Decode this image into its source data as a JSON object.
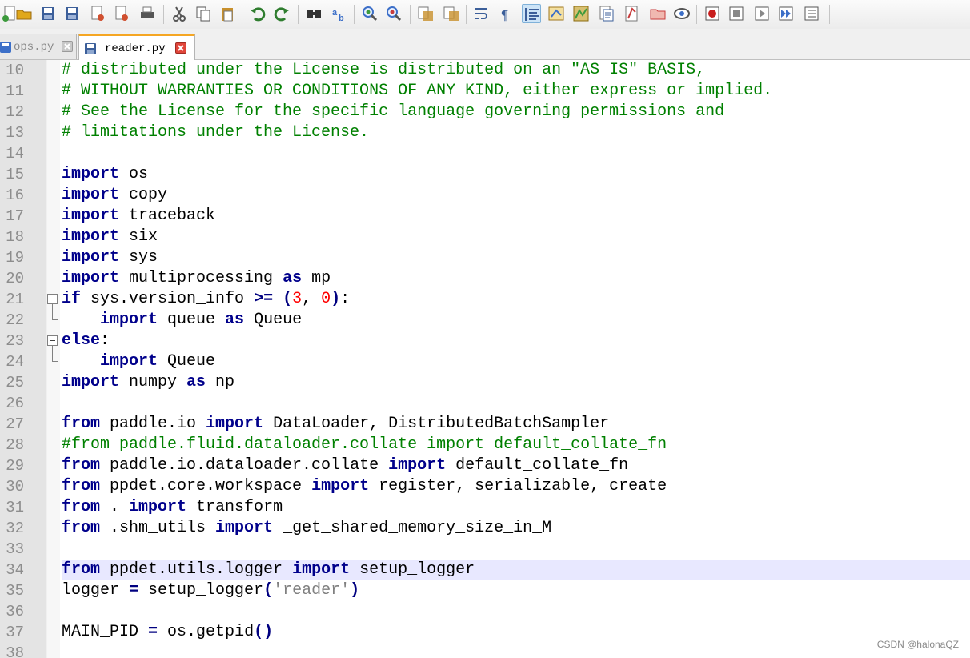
{
  "toolbar": {
    "buttons": [
      {
        "name": "new-file-icon",
        "color": "#3c9a3c"
      },
      {
        "name": "open-folder-icon",
        "color": "#e0a81c"
      },
      {
        "name": "save-icon",
        "color": "#3c5f9a"
      },
      {
        "name": "save-all-icon",
        "color": "#3c5f9a"
      },
      {
        "name": "close-icon",
        "color": "#d05030"
      },
      {
        "name": "close-all-icon",
        "color": "#d05030"
      },
      {
        "name": "print-icon",
        "color": "#555555"
      },
      {
        "name": "cut-icon",
        "color": "#555555"
      },
      {
        "name": "copy-icon",
        "color": "#555555"
      },
      {
        "name": "paste-icon",
        "color": "#c8902c"
      },
      {
        "name": "undo-icon",
        "color": "#2f7d2f"
      },
      {
        "name": "redo-icon",
        "color": "#2f7d2f"
      },
      {
        "name": "find-icon",
        "color": "#333333"
      },
      {
        "name": "replace-icon",
        "color": "#3c6fc8"
      },
      {
        "name": "zoom-in-icon",
        "color": "#3c9a3c"
      },
      {
        "name": "zoom-out-icon",
        "color": "#c83c3c"
      },
      {
        "name": "sync-vertical-icon",
        "color": "#c8902c"
      },
      {
        "name": "sync-horizontal-icon",
        "color": "#c8902c"
      },
      {
        "name": "word-wrap-icon",
        "color": "#3c5f9a"
      },
      {
        "name": "show-all-characters-icon",
        "color": "#3c5f9a"
      },
      {
        "name": "indent-guide-icon",
        "color": "#3c5f9a",
        "active": true
      },
      {
        "name": "user-defined-language-icon",
        "color": "#c8902c"
      },
      {
        "name": "document-map-icon",
        "color": "#c8902c"
      },
      {
        "name": "function-list-icon",
        "color": "#3c5f9a"
      },
      {
        "name": "folder-as-workspace-icon",
        "color": "#c83c3c"
      },
      {
        "name": "project-icon",
        "color": "#c83c3c"
      },
      {
        "name": "monitoring-icon",
        "color": "#555555"
      },
      {
        "name": "record-macro-icon",
        "color": "#c81e1e"
      },
      {
        "name": "stop-recording-icon",
        "color": "#555555"
      },
      {
        "name": "playback-macro-icon",
        "color": "#555555"
      },
      {
        "name": "run-macro-multiple-icon",
        "color": "#3c6fc8"
      },
      {
        "name": "save-macro-icon",
        "color": "#555555"
      }
    ]
  },
  "tabs": [
    {
      "label": "ops.py",
      "active": false
    },
    {
      "label": "reader.py",
      "active": true
    }
  ],
  "editor": {
    "current_line": 34,
    "lines": [
      {
        "n": "10",
        "t": [
          [
            "cm",
            "# distributed under the License is distributed on an \"AS IS\" BASIS,"
          ]
        ]
      },
      {
        "n": "11",
        "t": [
          [
            "cm",
            "# WITHOUT WARRANTIES OR CONDITIONS OF ANY KIND, either express or implied."
          ]
        ]
      },
      {
        "n": "12",
        "t": [
          [
            "cm",
            "# See the License for the specific language governing permissions and"
          ]
        ]
      },
      {
        "n": "13",
        "t": [
          [
            "cm",
            "# limitations under the License."
          ]
        ]
      },
      {
        "n": "14",
        "t": []
      },
      {
        "n": "15",
        "t": [
          [
            "kw",
            "import"
          ],
          [
            "id",
            " os"
          ]
        ]
      },
      {
        "n": "16",
        "t": [
          [
            "kw",
            "import"
          ],
          [
            "id",
            " copy"
          ]
        ]
      },
      {
        "n": "17",
        "t": [
          [
            "kw",
            "import"
          ],
          [
            "id",
            " traceback"
          ]
        ]
      },
      {
        "n": "18",
        "t": [
          [
            "kw",
            "import"
          ],
          [
            "id",
            " six"
          ]
        ]
      },
      {
        "n": "19",
        "t": [
          [
            "kw",
            "import"
          ],
          [
            "id",
            " sys"
          ]
        ]
      },
      {
        "n": "20",
        "t": [
          [
            "kw",
            "import"
          ],
          [
            "id",
            " multiprocessing "
          ],
          [
            "kw",
            "as"
          ],
          [
            "id",
            " mp"
          ]
        ]
      },
      {
        "n": "21",
        "t": [
          [
            "kw",
            "if"
          ],
          [
            "id",
            " sys.version_info "
          ],
          [
            "op",
            ">="
          ],
          [
            "id",
            " "
          ],
          [
            "op",
            "("
          ],
          [
            "num",
            "3"
          ],
          [
            "id",
            ", "
          ],
          [
            "num",
            "0"
          ],
          [
            "op",
            ")"
          ],
          [
            "id",
            ":"
          ]
        ]
      },
      {
        "n": "22",
        "t": [
          [
            "id",
            "    "
          ],
          [
            "kw",
            "import"
          ],
          [
            "id",
            " queue "
          ],
          [
            "kw",
            "as"
          ],
          [
            "id",
            " Queue"
          ]
        ]
      },
      {
        "n": "23",
        "t": [
          [
            "kw",
            "else"
          ],
          [
            "id",
            ":"
          ]
        ]
      },
      {
        "n": "24",
        "t": [
          [
            "id",
            "    "
          ],
          [
            "kw",
            "import"
          ],
          [
            "id",
            " Queue"
          ]
        ]
      },
      {
        "n": "25",
        "t": [
          [
            "kw",
            "import"
          ],
          [
            "id",
            " numpy "
          ],
          [
            "kw",
            "as"
          ],
          [
            "id",
            " np"
          ]
        ]
      },
      {
        "n": "26",
        "t": []
      },
      {
        "n": "27",
        "t": [
          [
            "kw",
            "from"
          ],
          [
            "id",
            " paddle.io "
          ],
          [
            "kw",
            "import"
          ],
          [
            "id",
            " DataLoader, DistributedBatchSampler"
          ]
        ]
      },
      {
        "n": "28",
        "t": [
          [
            "cm",
            "#from paddle.fluid.dataloader.collate import default_collate_fn"
          ]
        ]
      },
      {
        "n": "29",
        "t": [
          [
            "kw",
            "from"
          ],
          [
            "id",
            " paddle.io.dataloader.collate "
          ],
          [
            "kw",
            "import"
          ],
          [
            "id",
            " default_collate_fn"
          ]
        ]
      },
      {
        "n": "30",
        "t": [
          [
            "kw",
            "from"
          ],
          [
            "id",
            " ppdet.core.workspace "
          ],
          [
            "kw",
            "import"
          ],
          [
            "id",
            " register, serializable, create"
          ]
        ]
      },
      {
        "n": "31",
        "t": [
          [
            "kw",
            "from"
          ],
          [
            "id",
            " . "
          ],
          [
            "kw",
            "import"
          ],
          [
            "id",
            " transform"
          ]
        ]
      },
      {
        "n": "32",
        "t": [
          [
            "kw",
            "from"
          ],
          [
            "id",
            " .shm_utils "
          ],
          [
            "kw",
            "import"
          ],
          [
            "id",
            " _get_shared_memory_size_in_M"
          ]
        ]
      },
      {
        "n": "33",
        "t": []
      },
      {
        "n": "34",
        "t": [
          [
            "kw",
            "from"
          ],
          [
            "id",
            " ppdet.utils.logger "
          ],
          [
            "kw",
            "import"
          ],
          [
            "id",
            " setup_logger"
          ]
        ]
      },
      {
        "n": "35",
        "t": [
          [
            "id",
            "logger "
          ],
          [
            "op",
            "="
          ],
          [
            "id",
            " setup_logger"
          ],
          [
            "op",
            "("
          ],
          [
            "str",
            "'reader'"
          ],
          [
            "op",
            ")"
          ]
        ]
      },
      {
        "n": "36",
        "t": []
      },
      {
        "n": "37",
        "t": [
          [
            "id",
            "MAIN_PID "
          ],
          [
            "op",
            "="
          ],
          [
            "id",
            " os.getpid"
          ],
          [
            "op",
            "()"
          ]
        ]
      },
      {
        "n": "38",
        "t": []
      }
    ]
  },
  "watermark": "CSDN @halonaQZ"
}
